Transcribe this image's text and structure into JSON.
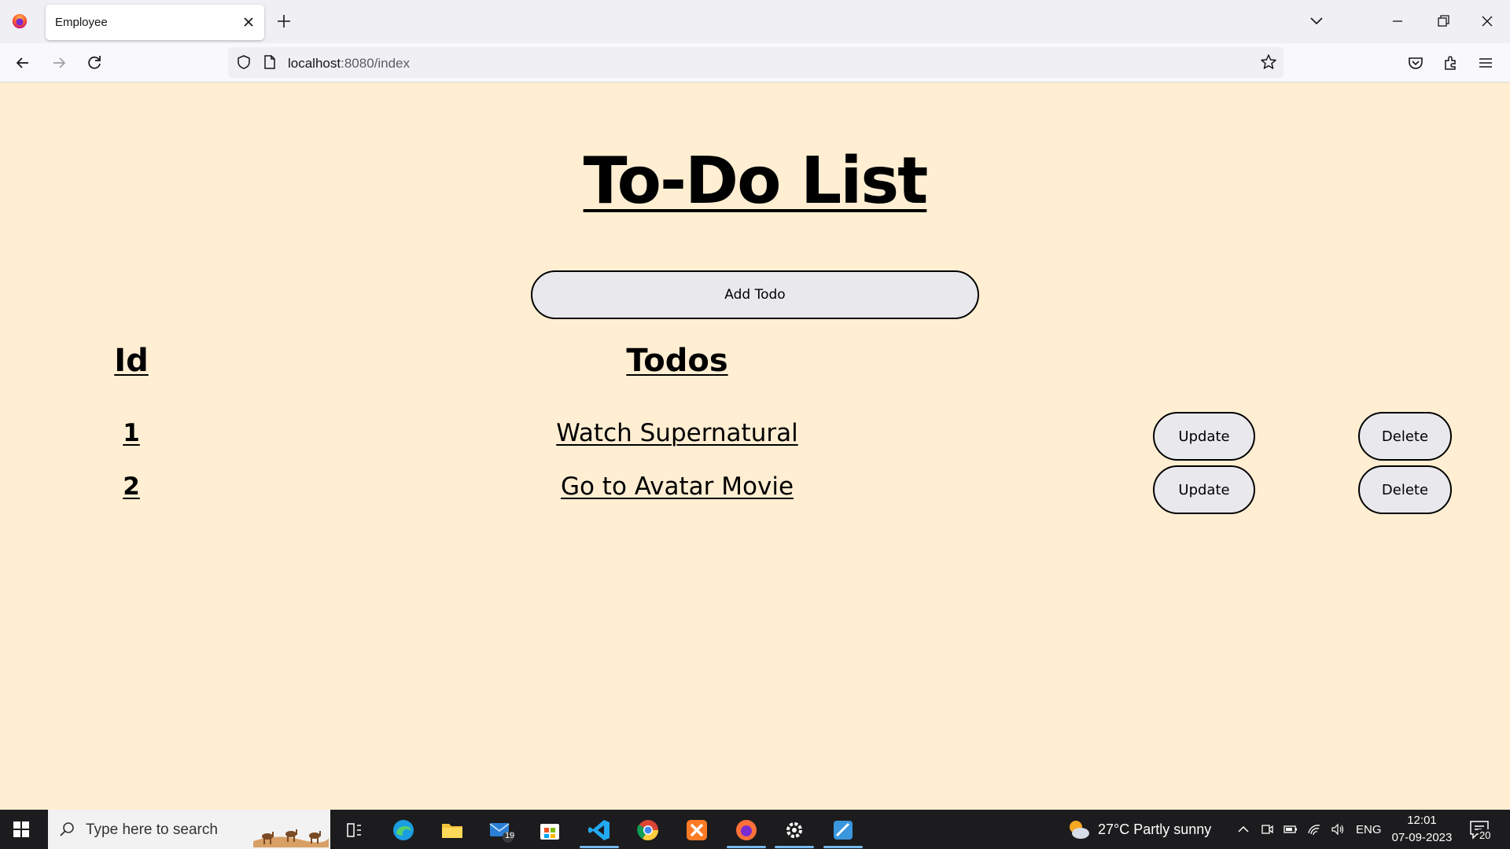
{
  "browser": {
    "tab_title": "Employee",
    "url_host": "localhost",
    "url_rest": ":8080/index"
  },
  "page": {
    "title": "To-Do List",
    "add_button": "Add Todo",
    "headers": {
      "id": "Id",
      "todos": "Todos"
    },
    "rows": [
      {
        "id": "1",
        "todo": "Watch Supernatural",
        "update": "Update",
        "delete": "Delete"
      },
      {
        "id": "2",
        "todo": "Go to Avatar Movie",
        "update": "Update",
        "delete": "Delete"
      }
    ]
  },
  "taskbar": {
    "search_placeholder": "Type here to search",
    "mail_badge": "19",
    "weather": "27°C  Partly sunny",
    "language": "ENG",
    "time": "12:01",
    "date": "07-09-2023",
    "notification_count": "20"
  },
  "colors": {
    "page_background": "#ffeed2",
    "button_background": "#e9e9ed",
    "taskbar": "#1c1c1e"
  }
}
